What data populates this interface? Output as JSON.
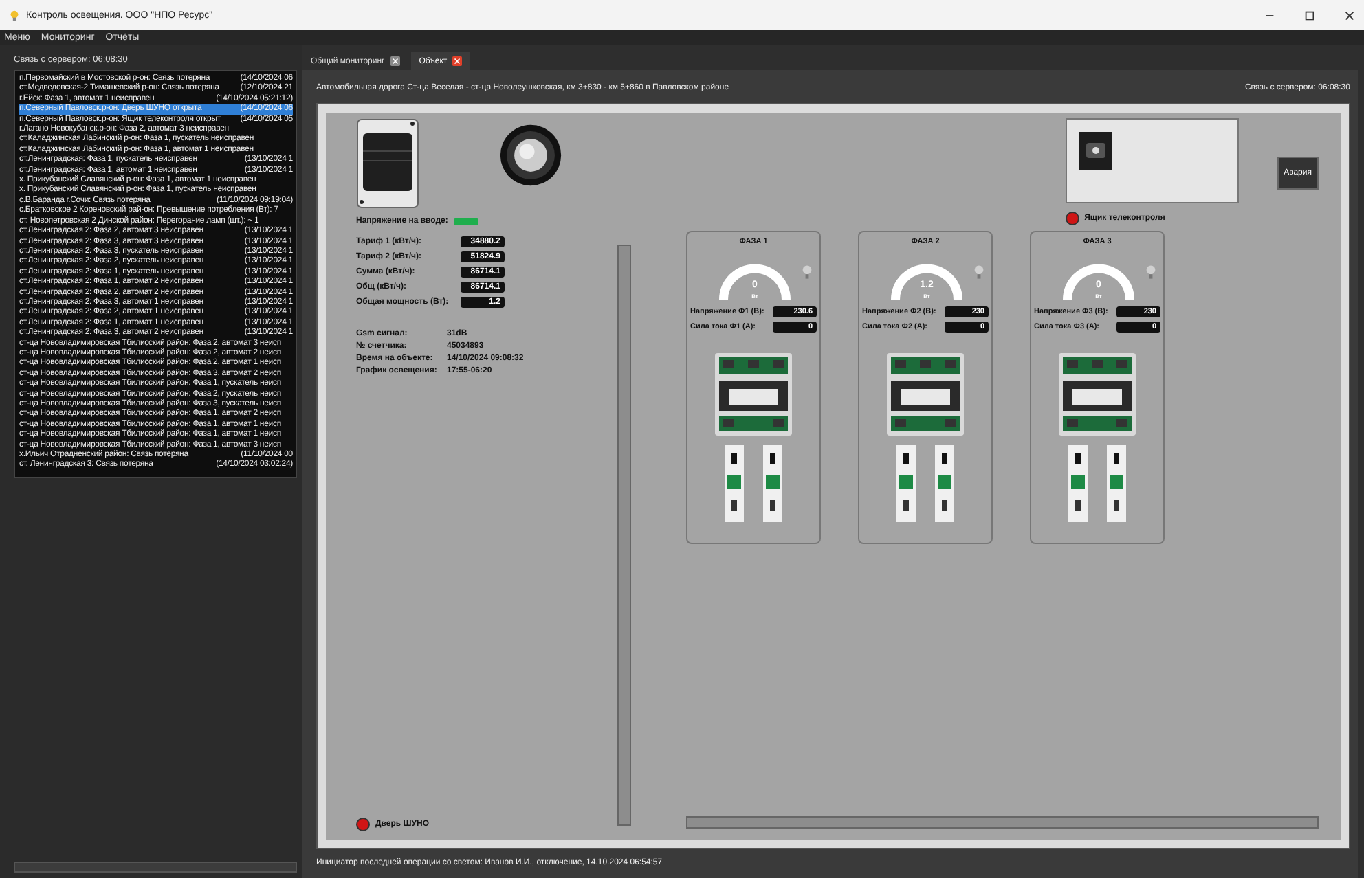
{
  "window": {
    "title": "Контроль освещения. ООО \"НПО Ресурс\""
  },
  "menu": [
    "Меню",
    "Мониторинг",
    "Отчёты"
  ],
  "sidebar": {
    "server_link": "Связь с сервером: 06:08:30",
    "events": [
      {
        "text": "п.Первомайский в Мостовской р-он: Связь потеряна",
        "time": "(14/10/2024 06",
        "selected": false
      },
      {
        "text": "ст.Медведовская-2 Тимашевский р-он: Связь потеряна",
        "time": "(12/10/2024 21",
        "selected": false
      },
      {
        "text": "г.Ейск: Фаза 1, автомат 1 неисправен",
        "time": "(14/10/2024 05:21:12)",
        "selected": false
      },
      {
        "text": "п.Северный Павловск.р-он: Дверь ШУНО открыта",
        "time": "(14/10/2024 06",
        "selected": true
      },
      {
        "text": "п.Северный Павловск.р-он: Ящик телеконтроля открыт",
        "time": "(14/10/2024 05",
        "selected": false
      },
      {
        "text": "г.Лагано Новокубанск.р-он: Фаза 2, автомат 3 неисправен",
        "selected": false
      },
      {
        "text": "ст.Каладжинская Лабинский р-он: Фаза 1, пускатель неисправен",
        "selected": false
      },
      {
        "text": "ст.Каладжинская Лабинский р-он: Фаза 1, автомат 1 неисправен",
        "selected": false
      },
      {
        "text": "ст.Ленинградская: Фаза 1, пускатель неисправен",
        "time": "(13/10/2024 1",
        "selected": false
      },
      {
        "text": "ст.Ленинградская: Фаза 1, автомат 1 неисправен",
        "time": "(13/10/2024 1",
        "selected": false
      },
      {
        "text": "х. Прикубанский Славянский р-он: Фаза 1, автомат 1 неисправен",
        "selected": false
      },
      {
        "text": "х. Прикубанский Славянский р-он: Фаза 1, пускатель неисправен",
        "selected": false
      },
      {
        "text": "с.В.Баранда г.Сочи: Связь потеряна",
        "time": "(11/10/2024 09:19:04)",
        "selected": false
      },
      {
        "text": "с.Братковское 2 Кореновский рай-он: Превышение потребления (Вт): 7",
        "selected": false
      },
      {
        "text": "ст. Новопетровская 2 Динской район: Перегорание ламп (шт.): ~ 1",
        "selected": false
      },
      {
        "text": "ст.Ленинградская 2: Фаза 2, автомат 3 неисправен",
        "time": "(13/10/2024 1",
        "selected": false
      },
      {
        "text": "ст.Ленинградская 2: Фаза 3, автомат 3 неисправен",
        "time": "(13/10/2024 1",
        "selected": false
      },
      {
        "text": "ст.Ленинградская 2: Фаза 3, пускатель неисправен",
        "time": "(13/10/2024 1",
        "selected": false
      },
      {
        "text": "ст.Ленинградская 2: Фаза 2, пускатель неисправен",
        "time": "(13/10/2024 1",
        "selected": false
      },
      {
        "text": "ст.Ленинградская 2: Фаза 1, пускатель неисправен",
        "time": "(13/10/2024 1",
        "selected": false
      },
      {
        "text": "ст.Ленинградская 2: Фаза 1, автомат 2 неисправен",
        "time": "(13/10/2024 1",
        "selected": false
      },
      {
        "text": "ст.Ленинградская 2: Фаза 2, автомат 2 неисправен",
        "time": "(13/10/2024 1",
        "selected": false
      },
      {
        "text": "ст.Ленинградская 2: Фаза 3, автомат 1 неисправен",
        "time": "(13/10/2024 1",
        "selected": false
      },
      {
        "text": "ст.Ленинградская 2: Фаза 2, автомат 1 неисправен",
        "time": "(13/10/2024 1",
        "selected": false
      },
      {
        "text": "ст.Ленинградская 2: Фаза 1, автомат 1 неисправен",
        "time": "(13/10/2024 1",
        "selected": false
      },
      {
        "text": "ст.Ленинградская 2: Фаза 3, автомат 2 неисправен",
        "time": "(13/10/2024 1",
        "selected": false
      },
      {
        "text": "ст-ца Нововладимировская Тбилисский район: Фаза 2, автомат 3 неисп",
        "selected": false
      },
      {
        "text": "ст-ца Нововладимировская Тбилисский район: Фаза 2, автомат 2 неисп",
        "selected": false
      },
      {
        "text": "ст-ца Нововладимировская Тбилисский район: Фаза 2, автомат 1 неисп",
        "selected": false
      },
      {
        "text": "ст-ца Нововладимировская Тбилисский район: Фаза 3, автомат 2 неисп",
        "selected": false
      },
      {
        "text": "ст-ца Нововладимировская Тбилисский район: Фаза 1, пускатель неисп",
        "selected": false
      },
      {
        "text": "ст-ца Нововладимировская Тбилисский район: Фаза 2, пускатель неисп",
        "selected": false
      },
      {
        "text": "ст-ца Нововладимировская Тбилисский район: Фаза 3, пускатель неисп",
        "selected": false
      },
      {
        "text": "ст-ца Нововладимировская Тбилисский район: Фаза 1, автомат 2 неисп",
        "selected": false
      },
      {
        "text": "ст-ца Нововладимировская Тбилисский район: Фаза 1, автомат 1 неисп",
        "selected": false
      },
      {
        "text": "ст-ца Нововладимировская Тбилисский район: Фаза 1, автомат 1 неисп",
        "selected": false
      },
      {
        "text": "ст-ца Нововладимировская Тбилисский район: Фаза 1, автомат 3 неисп",
        "selected": false
      },
      {
        "text": "х.Ильич Отрадненский район: Связь потеряна",
        "time": "(11/10/2024 00",
        "selected": false
      },
      {
        "text": "ст. Ленинградская 3: Связь потеряна",
        "time": "(14/10/2024 03:02:24)",
        "selected": false
      }
    ]
  },
  "tabs": [
    {
      "label": "Общий мониторинг",
      "selected": false
    },
    {
      "label": "Объект",
      "selected": true
    }
  ],
  "object": {
    "address": "Автомобильная дорога Ст-ца Веселая - ст-ца Новолеушковская, км 3+830 - км 5+860 в Павловском районе",
    "server_link": "Связь с сервером: 06:08:30",
    "input_voltage": {
      "label": "Напряжение на вводе:",
      "ok": true
    },
    "telecontrol_box": {
      "label": "Ящик телеконтроля",
      "alarm": true
    },
    "alarm_button": "Авария",
    "meters": [
      {
        "label": "Тариф 1 (кВт/ч):",
        "value": "34880.2"
      },
      {
        "label": "Тариф 2 (кВт/ч):",
        "value": "51824.9"
      },
      {
        "label": "Сумма (кВт/ч):",
        "value": "86714.1"
      },
      {
        "label": "Общ (кВт/ч):",
        "value": "86714.1"
      },
      {
        "label": "Общая мощность (Вт):",
        "value": "1.2"
      }
    ],
    "info": [
      {
        "label": "Gsm сигнал:",
        "value": "31dB"
      },
      {
        "label": "№ счетчика:",
        "value": "45034893"
      },
      {
        "label": "Время на объекте:",
        "value": "14/10/2024 09:08:32"
      },
      {
        "label": "График освещения:",
        "value": "17:55-06:20"
      }
    ],
    "phases": [
      {
        "title": "ФАЗА 1",
        "power": "0",
        "unit": "Вт",
        "lamp_on": false,
        "voltage_label": "Напряжение Ф1 (В):",
        "voltage": "230.6",
        "current_label": "Сила тока Ф1 (А):",
        "current": "0"
      },
      {
        "title": "ФАЗА 2",
        "power": "1.2",
        "unit": "Вт",
        "lamp_on": false,
        "voltage_label": "Напряжение Ф2 (В):",
        "voltage": "230",
        "current_label": "Сила тока Ф2 (А):",
        "current": "0"
      },
      {
        "title": "ФАЗА 3",
        "power": "0",
        "unit": "Вт",
        "lamp_on": false,
        "voltage_label": "Напряжение Ф3 (В):",
        "voltage": "230",
        "current_label": "Сила тока Ф3 (А):",
        "current": "0"
      }
    ],
    "door": {
      "label": "Дверь ШУНО",
      "alarm": true
    }
  },
  "status_bar": "Инициатор последней операции со светом: Иванов И.И., отключение, 14.10.2024 06:54:57"
}
